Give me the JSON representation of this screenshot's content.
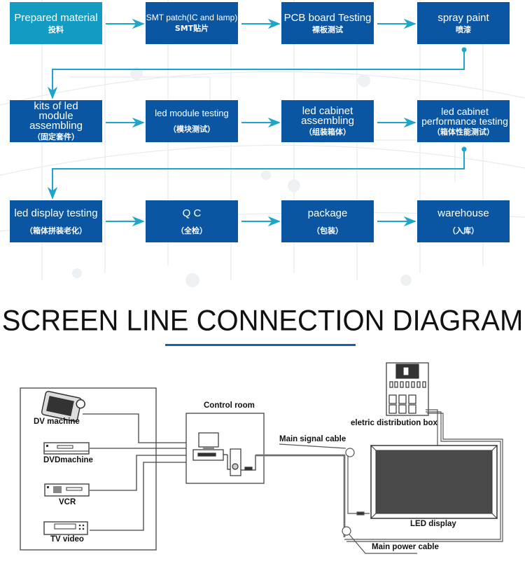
{
  "process_flow": {
    "rows": [
      [
        {
          "en": "Prepared material",
          "zh": "投料",
          "highlight": true
        },
        {
          "en": "SMT patch(IC and lamp)",
          "zh": "SMT贴片"
        },
        {
          "en": "PCB board Testing",
          "zh": "裸板测试"
        },
        {
          "en": "spray paint",
          "zh": "喷漆"
        }
      ],
      [
        {
          "en": "kits of led module assembling",
          "zh": "（固定套件）"
        },
        {
          "en": "led module testing",
          "zh": "（模块测试）"
        },
        {
          "en": "led cabinet assembling",
          "zh": "（组装箱体）"
        },
        {
          "en": "led cabinet performance testing",
          "zh": "（箱体性能测试）"
        }
      ],
      [
        {
          "en": "led display testing",
          "zh": "（箱体拼装老化）"
        },
        {
          "en": "Q C",
          "zh": "（全检）"
        },
        {
          "en": "package",
          "zh": "（包装）"
        },
        {
          "en": "warehouse",
          "zh": "（入库）"
        }
      ]
    ],
    "colors": {
      "primary": "#0b56a3",
      "highlight": "#129cc4",
      "connector": "#1ea5c9"
    }
  },
  "section_title": "SCREEN LINE CONNECTION DIAGRAM",
  "diagram": {
    "sources": [
      "DV machine",
      "DVDmachine",
      "VCR",
      "TV video"
    ],
    "control_room_label": "Control room",
    "main_signal_cable_label": "Main signal cable",
    "distribution_box_label": "eletric distribution box",
    "led_display_label": "LED display",
    "main_power_cable_label": "Main power cable"
  }
}
